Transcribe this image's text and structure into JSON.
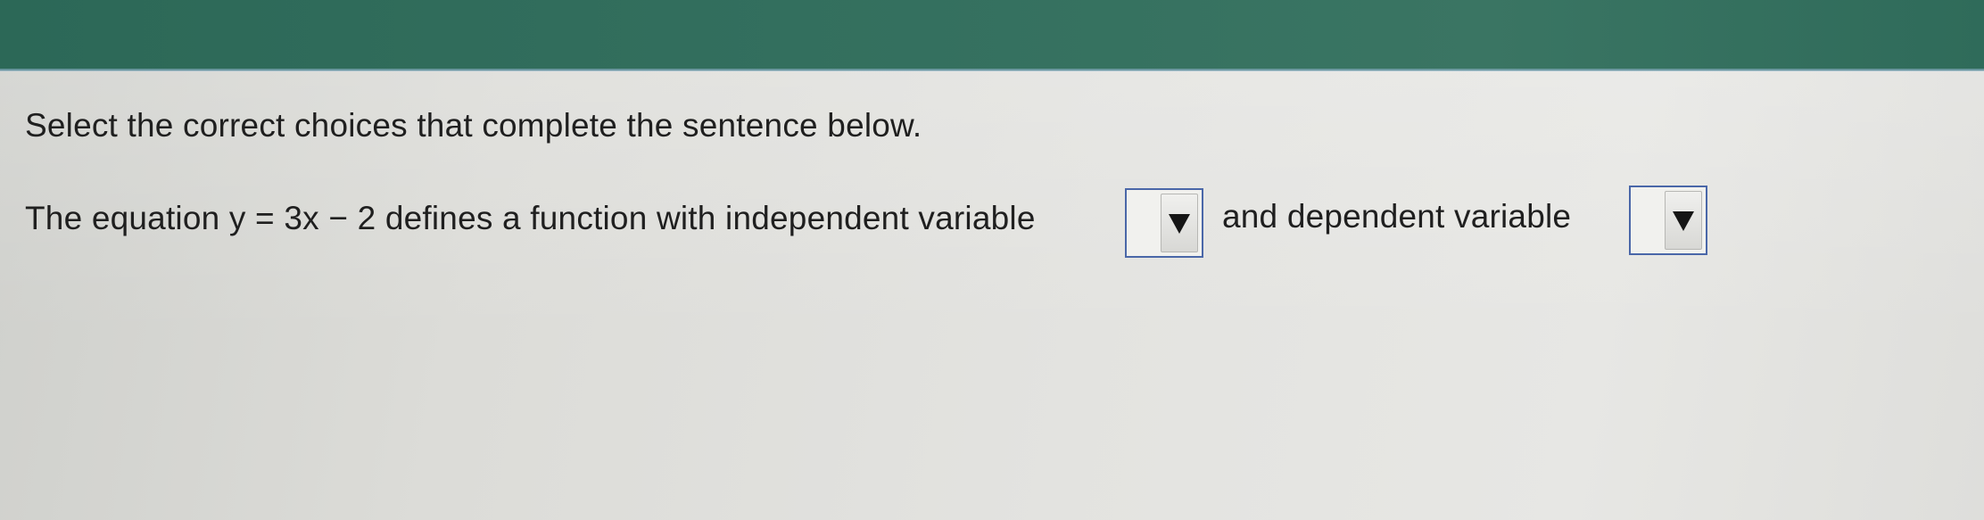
{
  "instruction": "Select the correct choices that complete the sentence below.",
  "sentence": {
    "part1": "The equation y = 3x − 2 defines a function with independent variable",
    "part2": "and dependent variable"
  },
  "dropdowns": {
    "independent_variable": {
      "selected": ""
    },
    "dependent_variable": {
      "selected": ""
    }
  },
  "icons": {
    "dropdown_arrow": "triangle-down-icon"
  }
}
